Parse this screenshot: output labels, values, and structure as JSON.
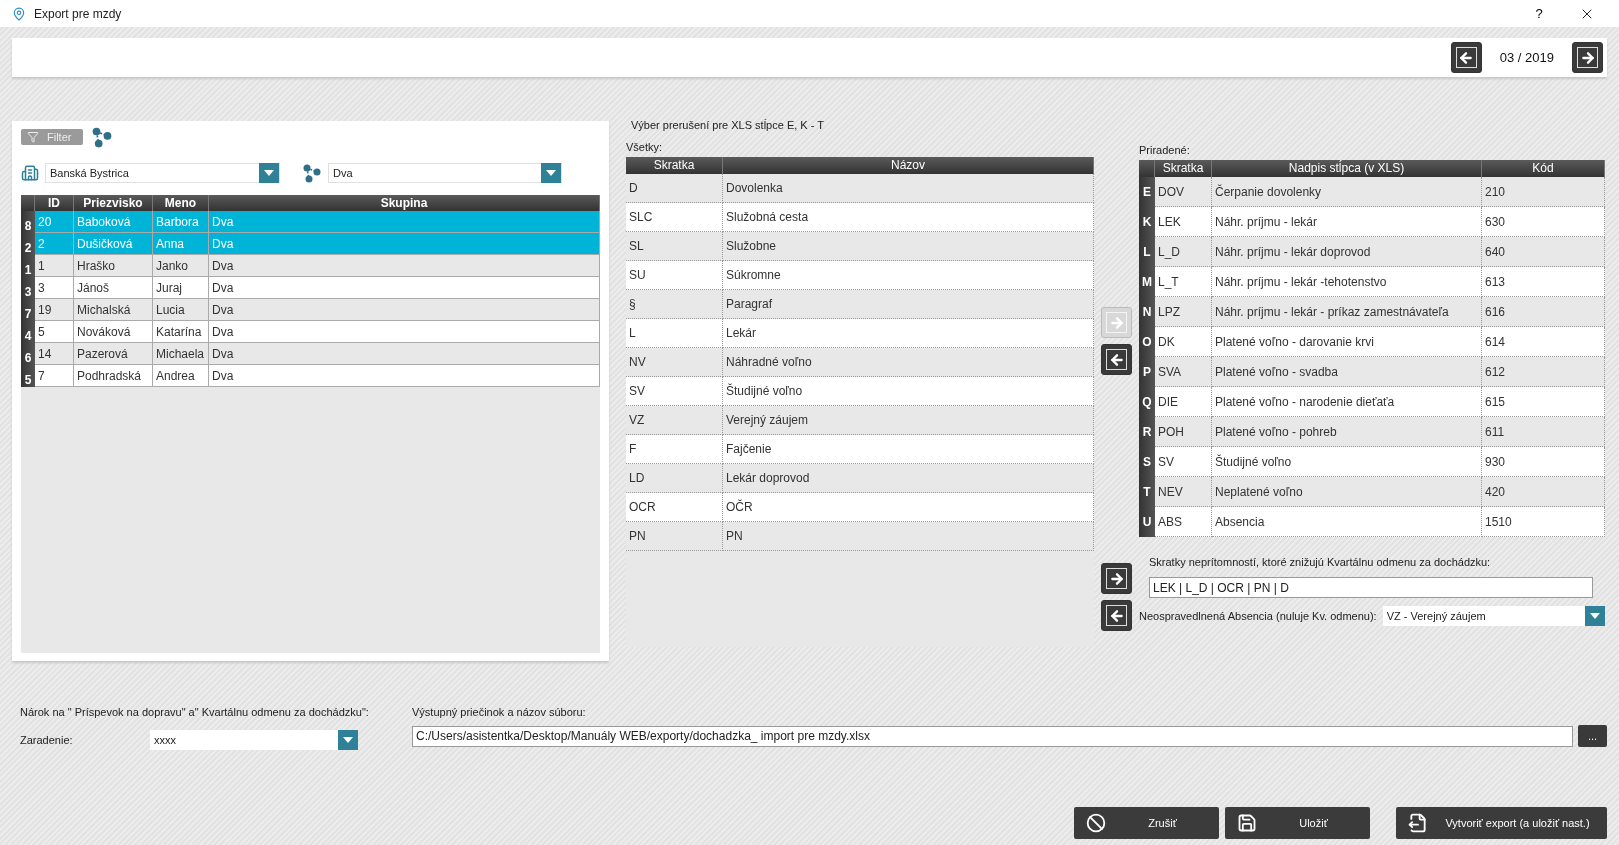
{
  "window": {
    "title": "Export pre mzdy",
    "help": "?"
  },
  "period": {
    "value": "03 / 2019"
  },
  "filter": {
    "label": "Filter"
  },
  "location": {
    "value": "Banská Bystrica"
  },
  "group": {
    "value": "Dva"
  },
  "employees": {
    "columns": [
      "ID",
      "Priezvisko",
      "Meno",
      "Skupina"
    ],
    "rows": [
      {
        "index": "8",
        "cells": [
          "20",
          "Baboková",
          "Barbora",
          "Dva"
        ],
        "selected": true
      },
      {
        "index": "2",
        "cells": [
          "2",
          "Dušičková",
          "Anna",
          "Dva"
        ],
        "selected": true
      },
      {
        "index": "1",
        "cells": [
          "1",
          "Hraško",
          "Janko",
          "Dva"
        ],
        "selected": false
      },
      {
        "index": "3",
        "cells": [
          "3",
          "Jánoš",
          "Juraj",
          "Dva"
        ],
        "selected": false
      },
      {
        "index": "7",
        "cells": [
          "19",
          "Michalská",
          "Lucia",
          "Dva"
        ],
        "selected": false
      },
      {
        "index": "4",
        "cells": [
          "5",
          "Nováková",
          "Katarína",
          "Dva"
        ],
        "selected": false
      },
      {
        "index": "6",
        "cells": [
          "14",
          "Pazerová",
          "Michaela",
          "Dva"
        ],
        "selected": false
      },
      {
        "index": "5",
        "cells": [
          "7",
          "Podhradská",
          "Andrea",
          "Dva"
        ],
        "selected": false
      }
    ]
  },
  "breaks": {
    "title": "Výber prerušení  pre XLS stĺpce E, K - T",
    "all_label": "Všetky:",
    "all_columns": [
      "Skratka",
      "Názov"
    ],
    "all_rows": [
      [
        "D",
        "Dovolenka"
      ],
      [
        "SLC",
        "Služobná cesta"
      ],
      [
        "SL",
        "Služobne"
      ],
      [
        "SU",
        "Súkromne"
      ],
      [
        "§",
        "Paragraf"
      ],
      [
        "L",
        "Lekár"
      ],
      [
        "NV",
        "Náhradné voľno"
      ],
      [
        "SV",
        "Študijné voľno"
      ],
      [
        "VZ",
        "Verejný záujem"
      ],
      [
        "F",
        "Fajčenie"
      ],
      [
        "LD",
        "Lekár doprovod"
      ],
      [
        "OCR",
        "OČR"
      ],
      [
        "PN",
        "PN"
      ]
    ],
    "assigned_label": "Priradené:",
    "assigned_columns": [
      "Skratka",
      "Nadpis stĺpca (v XLS)",
      "Kód"
    ],
    "assigned_rows": [
      {
        "letter": "E",
        "cells": [
          "DOV",
          "Čerpanie dovolenky",
          "210"
        ]
      },
      {
        "letter": "K",
        "cells": [
          "LEK",
          "Náhr. príjmu - lekár",
          "630"
        ]
      },
      {
        "letter": "L",
        "cells": [
          "L_D",
          "Náhr. príjmu - lekár doprovod",
          "640"
        ]
      },
      {
        "letter": "M",
        "cells": [
          "L_T",
          "Náhr. príjmu - lekár -tehotenstvo",
          "613"
        ]
      },
      {
        "letter": "N",
        "cells": [
          "LPZ",
          "Náhr. príjmu - lekár - príkaz zamestnávateľa",
          "616"
        ]
      },
      {
        "letter": "O",
        "cells": [
          "DK",
          "Platené voľno - darovanie krvi",
          "614"
        ]
      },
      {
        "letter": "P",
        "cells": [
          "SVA",
          "Platené voľno - svadba",
          "612"
        ]
      },
      {
        "letter": "Q",
        "cells": [
          "DIE",
          "Platené voľno - narodenie dieťaťa",
          "615"
        ]
      },
      {
        "letter": "R",
        "cells": [
          "POH",
          "Platené voľno - pohreb",
          "611"
        ]
      },
      {
        "letter": "S",
        "cells": [
          "SV",
          "Študijné voľno",
          "930"
        ]
      },
      {
        "letter": "T",
        "cells": [
          "NEV",
          "Neplatené voľno",
          "420"
        ]
      },
      {
        "letter": "U",
        "cells": [
          "ABS",
          "Absencia",
          "1510"
        ]
      }
    ]
  },
  "transfer_buttons": [
    {
      "kind": "right",
      "disabled": true
    },
    {
      "kind": "left",
      "disabled": false
    }
  ],
  "reduce": {
    "label": "Skratky neprítomností, ktoré znižujú Kvartálnu odmenu za dochádzku:",
    "value": "LEK | L_D | OCR | PN | D",
    "buttons": [
      {
        "kind": "right",
        "disabled": false
      },
      {
        "kind": "left",
        "disabled": false
      }
    ]
  },
  "absence": {
    "label": "Neospravedlnená Absencia (nuluje Kv. odmenu):",
    "value": "VZ -  Verejný záujem"
  },
  "entitlement": {
    "label": "Nárok na \" Príspevok na dopravu\" a\" Kvartálnu odmenu za dochádzku\":",
    "field_label": "Zaradenie:",
    "value": "xxxx"
  },
  "output": {
    "label": "Výstupný priečinok a názov súboru:",
    "value": "C:/Users/asistentka/Desktop/Manuály WEB/exporty/dochadzka_ import pre mzdy.xlsx",
    "browse": "..."
  },
  "actions": [
    {
      "kind": "cancel",
      "label": "Zrušiť"
    },
    {
      "kind": "save",
      "label": "Uložiť"
    },
    {
      "kind": "export",
      "label": "Vytvoriť export (a uložiť nast.)"
    }
  ]
}
